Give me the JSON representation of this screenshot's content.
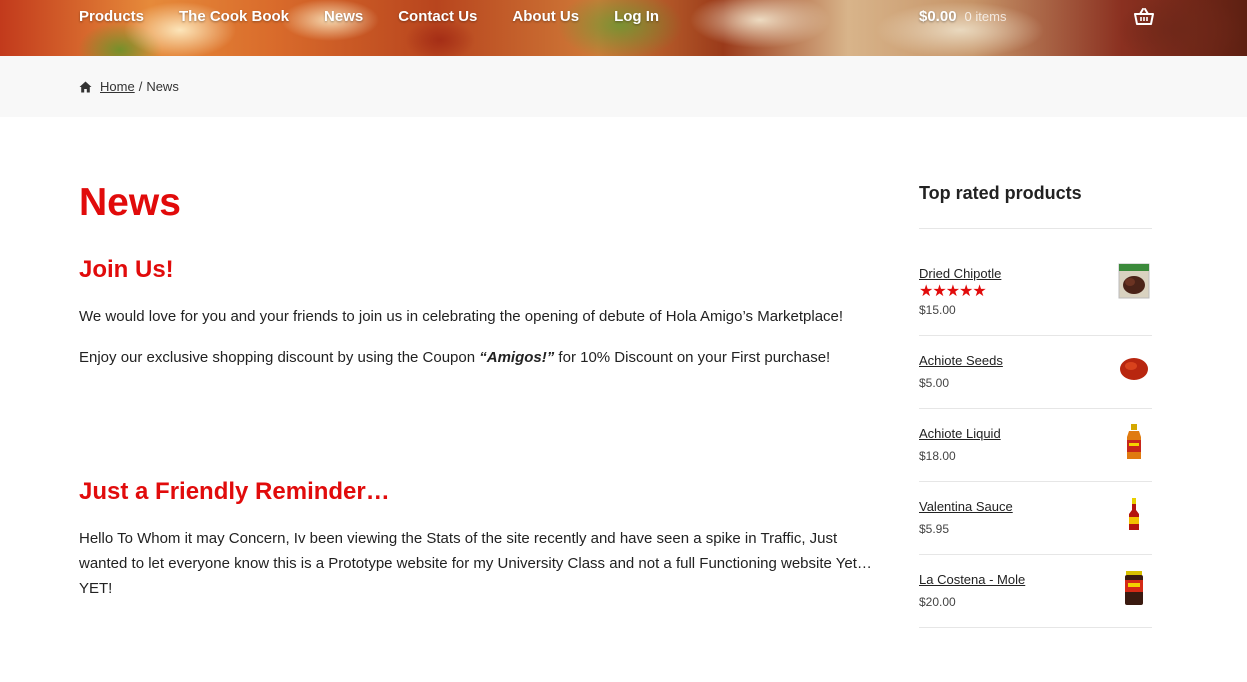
{
  "nav": {
    "items": [
      "Products",
      "The Cook Book",
      "News",
      "Contact Us",
      "About Us",
      "Log In"
    ]
  },
  "cart": {
    "total": "$0.00",
    "count": "0 items",
    "icon": "basket-icon"
  },
  "breadcrumb": {
    "home": "Home",
    "separator": "/",
    "current": "News",
    "icon": "home-icon"
  },
  "page": {
    "title": "News"
  },
  "posts": [
    {
      "title": "Join Us!",
      "p1": "We would love for you and your friends to join us in celebrating the opening of debute of Hola Amigo’s Marketplace!",
      "p2_before": "Enjoy our exclusive shopping discount by using the Coupon ",
      "p2_coupon": "“Amigos!”",
      "p2_after": " for 10% Discount on your First purchase!"
    },
    {
      "title": "Just a Friendly Reminder…",
      "p1": "Hello To Whom it may Concern, Iv been viewing the Stats of the site recently and have seen a spike in Traffic, Just wanted to let everyone know this is a Prototype website for my University Class and not a full Functioning website Yet… YET!"
    }
  ],
  "sidebar": {
    "title": "Top rated products",
    "products": [
      {
        "name": "Dried Chipotle",
        "price": "$15.00",
        "rating": 5,
        "stars": "★★★★★"
      },
      {
        "name": "Achiote Seeds",
        "price": "$5.00"
      },
      {
        "name": "Achiote Liquid",
        "price": "$18.00"
      },
      {
        "name": "Valentina Sauce",
        "price": "$5.95"
      },
      {
        "name": "La Costena - Mole",
        "price": "$20.00"
      }
    ]
  },
  "colors": {
    "accent": "#e10b0b",
    "breadcrumb_bg": "#f8f8f8",
    "divider": "#e6e6e6"
  }
}
